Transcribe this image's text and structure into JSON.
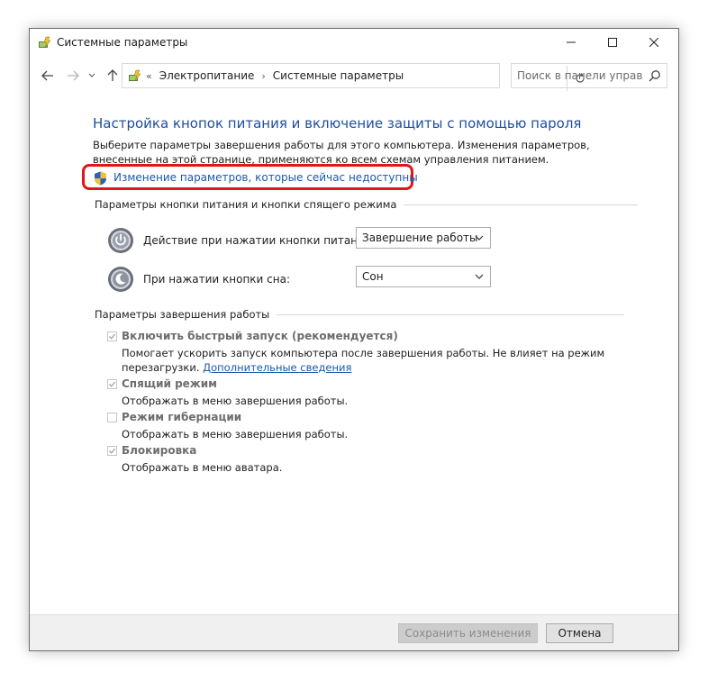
{
  "window": {
    "title": "Системные параметры",
    "controls": {
      "minimize": "minimize-icon",
      "maximize": "maximize-icon",
      "close": "close-icon"
    }
  },
  "nav": {
    "back": "arrow-left-icon",
    "forward": "arrow-right-icon",
    "recent": "chevron-down-icon",
    "up": "arrow-up-icon"
  },
  "address": {
    "overflow": "«",
    "crumbs": [
      "Электропитание",
      "Системные параметры"
    ],
    "separator": "›",
    "refresh": "refresh-icon"
  },
  "search": {
    "placeholder": "Поиск в панели управл..."
  },
  "main": {
    "title": "Настройка кнопок питания и включение защиты с помощью пароля",
    "description": "Выберите параметры завершения работы для этого компьютера. Изменения параметров, внесенные на этой странице, применяются ко всем схемам управления питанием.",
    "change_link": "Изменение параметров, которые сейчас недоступны",
    "power_group": {
      "heading": "Параметры кнопки питания и кнопки спящего режима",
      "power_button": {
        "label": "Действие при нажатии кнопки питания:",
        "value": "Завершение работы"
      },
      "sleep_button": {
        "label": "При нажатии кнопки сна:",
        "value": "Сон"
      }
    },
    "shutdown_group": {
      "heading": "Параметры завершения работы",
      "options": [
        {
          "title": "Включить быстрый запуск (рекомендуется)",
          "desc": "Помогает ускорить запуск компьютера после завершения работы. Не влияет на режим перезагрузки.",
          "link": "Дополнительные сведения",
          "checked": true
        },
        {
          "title": "Спящий режим",
          "desc": "Отображать в меню завершения работы.",
          "checked": true
        },
        {
          "title": "Режим гибернации",
          "desc": "Отображать в меню завершения работы.",
          "checked": false
        },
        {
          "title": "Блокировка",
          "desc": "Отображать в меню аватара.",
          "checked": true
        }
      ]
    }
  },
  "footer": {
    "save": "Сохранить изменения",
    "cancel": "Отмена"
  },
  "colors": {
    "accent_link": "#1a5aa8",
    "title_blue": "#1f4e9c",
    "highlight": "#e0161b"
  }
}
